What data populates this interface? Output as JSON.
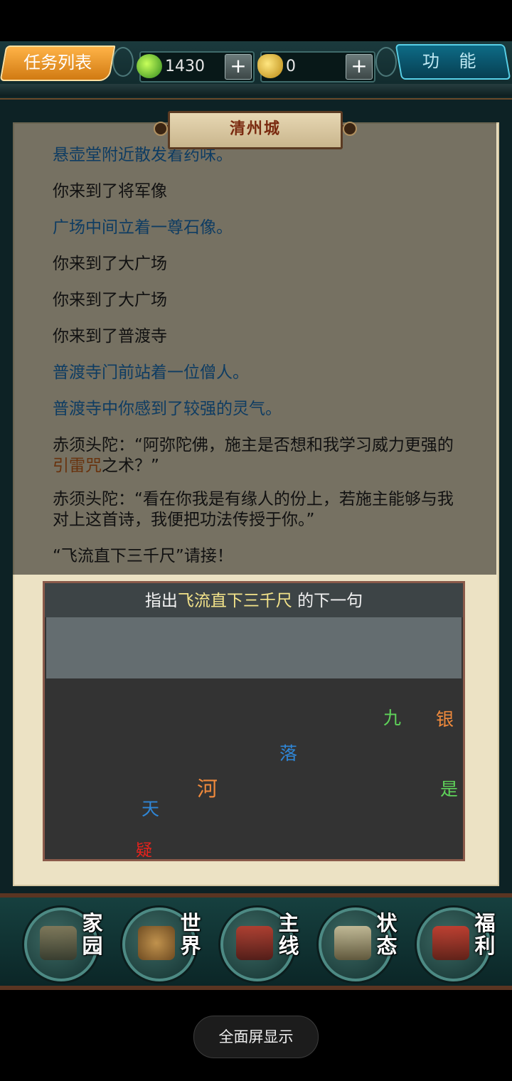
{
  "topbar": {
    "task_list": "任务列表",
    "function": "功 能",
    "coins": "1430",
    "ingots": "0",
    "plus": "+"
  },
  "location": "清州城",
  "log": [
    "悬壶堂附近散发着药味。",
    "你来到了将军像",
    "广场中间立着一尊石像。",
    "你来到了大广场",
    "你来到了大广场",
    "你来到了普渡寺",
    "普渡寺门前站着一位僧人。",
    "普渡寺中你感到了较强的灵气。"
  ],
  "dialog": {
    "line1_pre": "赤须头陀：“阿弥陀佛，施主是否想和我学习威力更强的",
    "line1_skill": "引雷咒",
    "line1_post": "之术？”",
    "line2": "赤须头陀：“看在你我是有缘人的份上，若施主能够与我对上这首诗，我便把功法传授于你。”",
    "line3": "“飞流直下三千尺”请接！"
  },
  "puzzle": {
    "prompt_pre": "指出",
    "prompt_poem": "飞流直下三千尺",
    "prompt_post": " 的下一句",
    "chars": {
      "jiu": "九",
      "yin": "银",
      "luo": "落",
      "he": "河",
      "shi": "是",
      "tian": "天",
      "yi": "疑"
    },
    "char_colors": {
      "green": "#5fd35a",
      "orange": "#f08a3c",
      "blue": "#2f86d6",
      "red": "#e8221c"
    }
  },
  "nav": {
    "home": "家园",
    "world": "世界",
    "main": "主线",
    "status": "状态",
    "welfare": "福利"
  },
  "fullscreen": "全面屏显示",
  "colors": {
    "log_blue": "#1d78c4",
    "skill_orange": "#d0641a",
    "task_orange": "#e58a1f",
    "function_teal": "#0d6b86"
  }
}
